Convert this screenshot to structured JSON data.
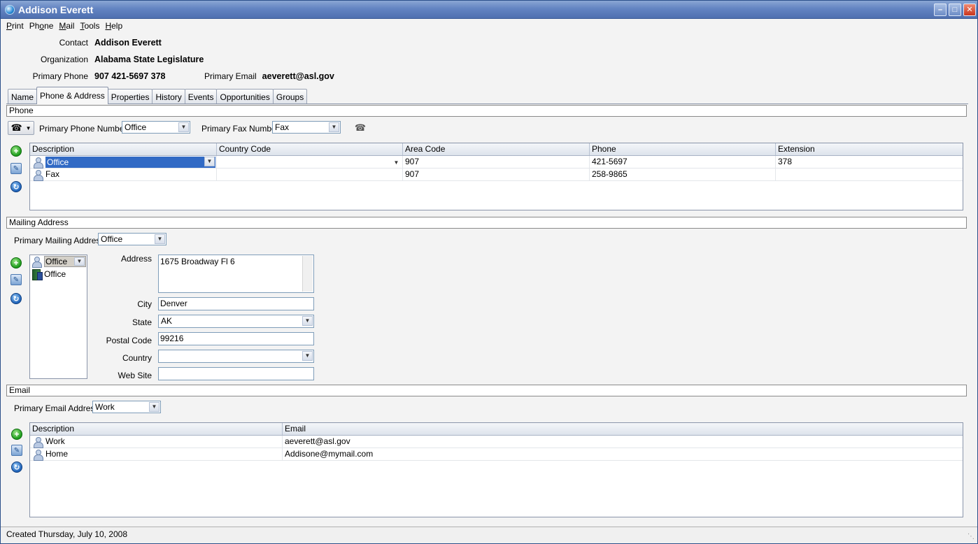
{
  "window": {
    "title": "Addison Everett"
  },
  "menu": [
    {
      "label": "Print",
      "accel": "P"
    },
    {
      "label": "Phone",
      "accel": "o"
    },
    {
      "label": "Mail",
      "accel": "M"
    },
    {
      "label": "Tools",
      "accel": "T"
    },
    {
      "label": "Help",
      "accel": "H"
    }
  ],
  "header": {
    "contact_label": "Contact",
    "contact_value": "Addison Everett",
    "org_label": "Organization",
    "org_value": "Alabama State Legislature",
    "phone_label": "Primary Phone",
    "phone_value": "907 421-5697 378",
    "email_label": "Primary Email",
    "email_value": "aeverett@asl.gov"
  },
  "tabs": [
    {
      "label": "Name",
      "active": false
    },
    {
      "label": "Phone & Address",
      "active": true
    },
    {
      "label": "Properties",
      "active": false
    },
    {
      "label": "History",
      "active": false
    },
    {
      "label": "Events",
      "active": false
    },
    {
      "label": "Opportunities",
      "active": false
    },
    {
      "label": "Groups",
      "active": false
    }
  ],
  "phone_section": {
    "title": "Phone",
    "primary_phone_label": "Primary Phone Number",
    "primary_phone_value": "Office",
    "primary_fax_label": "Primary Fax Number",
    "primary_fax_value": "Fax",
    "columns": [
      "Description",
      "Country Code",
      "Area Code",
      "Phone",
      "Extension"
    ],
    "rows": [
      {
        "description": "Office",
        "country_code": "",
        "area_code": "907",
        "phone": "421-5697",
        "extension": "378"
      },
      {
        "description": "Fax",
        "country_code": "",
        "area_code": "907",
        "phone": "258-9865",
        "extension": ""
      }
    ]
  },
  "mailing_section": {
    "title": "Mailing Address",
    "primary_label": "Primary Mailing Address",
    "primary_value": "Office",
    "list": [
      {
        "label": "Office",
        "icon": "person-icon"
      },
      {
        "label": "Office",
        "icon": "building-icon"
      }
    ],
    "address_label": "Address",
    "address_value": "1675 Broadway Fl 6",
    "city_label": "City",
    "city_value": "Denver",
    "state_label": "State",
    "state_value": "AK",
    "postal_label": "Postal Code",
    "postal_value": "99216",
    "country_label": "Country",
    "country_value": "",
    "website_label": "Web Site",
    "website_value": ""
  },
  "email_section": {
    "title": "Email",
    "primary_label": "Primary Email Address",
    "primary_value": "Work",
    "columns": [
      "Description",
      "Email"
    ],
    "rows": [
      {
        "description": "Work",
        "email": "aeverett@asl.gov"
      },
      {
        "description": "Home",
        "email": "Addisone@mymail.com"
      }
    ]
  },
  "status": {
    "text": "Created Thursday, July 10, 2008"
  },
  "colors": {
    "title_bar": "#6384c2",
    "selection": "#316ac5"
  }
}
